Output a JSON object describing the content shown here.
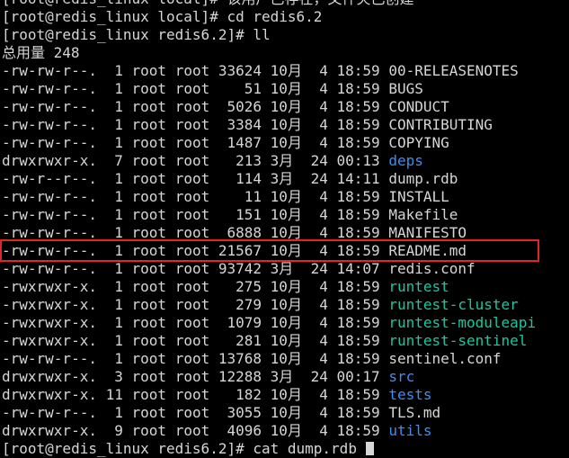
{
  "terminal": {
    "lines": [
      "[root@redis_linux local]# 该用户已存在，文件夹已创建",
      "[root@redis_linux local]# cd redis6.2",
      "[root@redis_linux redis6.2]# ll",
      "总用量 248"
    ],
    "files": [
      {
        "perm": "-rw-rw-r--.",
        "links": " 1",
        "owner": "root",
        "group": "root",
        "size": "33624",
        "month": "10月",
        "day": " 4",
        "time": "18:59",
        "name": "00-RELEASENOTES",
        "kind": "file"
      },
      {
        "perm": "-rw-rw-r--.",
        "links": " 1",
        "owner": "root",
        "group": "root",
        "size": "   51",
        "month": "10月",
        "day": " 4",
        "time": "18:59",
        "name": "BUGS",
        "kind": "file"
      },
      {
        "perm": "-rw-rw-r--.",
        "links": " 1",
        "owner": "root",
        "group": "root",
        "size": " 5026",
        "month": "10月",
        "day": " 4",
        "time": "18:59",
        "name": "CONDUCT",
        "kind": "file"
      },
      {
        "perm": "-rw-rw-r--.",
        "links": " 1",
        "owner": "root",
        "group": "root",
        "size": " 3384",
        "month": "10月",
        "day": " 4",
        "time": "18:59",
        "name": "CONTRIBUTING",
        "kind": "file"
      },
      {
        "perm": "-rw-rw-r--.",
        "links": " 1",
        "owner": "root",
        "group": "root",
        "size": " 1487",
        "month": "10月",
        "day": " 4",
        "time": "18:59",
        "name": "COPYING",
        "kind": "file"
      },
      {
        "perm": "drwxrwxr-x.",
        "links": " 7",
        "owner": "root",
        "group": "root",
        "size": "  213",
        "month": "3月 ",
        "day": "24",
        "time": "00:13",
        "name": "deps",
        "kind": "dir"
      },
      {
        "perm": "-rw-r--r--.",
        "links": " 1",
        "owner": "root",
        "group": "root",
        "size": "  114",
        "month": "3月 ",
        "day": "24",
        "time": "14:11",
        "name": "dump.rdb",
        "kind": "file"
      },
      {
        "perm": "-rw-rw-r--.",
        "links": " 1",
        "owner": "root",
        "group": "root",
        "size": "   11",
        "month": "10月",
        "day": " 4",
        "time": "18:59",
        "name": "INSTALL",
        "kind": "file"
      },
      {
        "perm": "-rw-rw-r--.",
        "links": " 1",
        "owner": "root",
        "group": "root",
        "size": "  151",
        "month": "10月",
        "day": " 4",
        "time": "18:59",
        "name": "Makefile",
        "kind": "file"
      },
      {
        "perm": "-rw-rw-r--.",
        "links": " 1",
        "owner": "root",
        "group": "root",
        "size": " 6888",
        "month": "10月",
        "day": " 4",
        "time": "18:59",
        "name": "MANIFESTO",
        "kind": "file"
      },
      {
        "perm": "-rw-rw-r--.",
        "links": " 1",
        "owner": "root",
        "group": "root",
        "size": "21567",
        "month": "10月",
        "day": " 4",
        "time": "18:59",
        "name": "README.md",
        "kind": "file"
      },
      {
        "perm": "-rw-rw-r--.",
        "links": " 1",
        "owner": "root",
        "group": "root",
        "size": "93742",
        "month": "3月 ",
        "day": "24",
        "time": "14:07",
        "name": "redis.conf",
        "kind": "file"
      },
      {
        "perm": "-rwxrwxr-x.",
        "links": " 1",
        "owner": "root",
        "group": "root",
        "size": "  275",
        "month": "10月",
        "day": " 4",
        "time": "18:59",
        "name": "runtest",
        "kind": "exec"
      },
      {
        "perm": "-rwxrwxr-x.",
        "links": " 1",
        "owner": "root",
        "group": "root",
        "size": "  279",
        "month": "10月",
        "day": " 4",
        "time": "18:59",
        "name": "runtest-cluster",
        "kind": "exec"
      },
      {
        "perm": "-rwxrwxr-x.",
        "links": " 1",
        "owner": "root",
        "group": "root",
        "size": " 1079",
        "month": "10月",
        "day": " 4",
        "time": "18:59",
        "name": "runtest-moduleapi",
        "kind": "exec"
      },
      {
        "perm": "-rwxrwxr-x.",
        "links": " 1",
        "owner": "root",
        "group": "root",
        "size": "  281",
        "month": "10月",
        "day": " 4",
        "time": "18:59",
        "name": "runtest-sentinel",
        "kind": "exec"
      },
      {
        "perm": "-rw-rw-r--.",
        "links": " 1",
        "owner": "root",
        "group": "root",
        "size": "13768",
        "month": "10月",
        "day": " 4",
        "time": "18:59",
        "name": "sentinel.conf",
        "kind": "file"
      },
      {
        "perm": "drwxrwxr-x.",
        "links": " 3",
        "owner": "root",
        "group": "root",
        "size": "12288",
        "month": "3月 ",
        "day": "24",
        "time": "00:17",
        "name": "src",
        "kind": "dir"
      },
      {
        "perm": "drwxrwxr-x.",
        "links": "11",
        "owner": "root",
        "group": "root",
        "size": "  182",
        "month": "10月",
        "day": " 4",
        "time": "18:59",
        "name": "tests",
        "kind": "dir"
      },
      {
        "perm": "-rw-rw-r--.",
        "links": " 1",
        "owner": "root",
        "group": "root",
        "size": " 3055",
        "month": "10月",
        "day": " 4",
        "time": "18:59",
        "name": "TLS.md",
        "kind": "file"
      },
      {
        "perm": "drwxrwxr-x.",
        "links": " 9",
        "owner": "root",
        "group": "root",
        "size": " 4096",
        "month": "10月",
        "day": " 4",
        "time": "18:59",
        "name": "utils",
        "kind": "dir"
      }
    ],
    "last_prompt": "[root@redis_linux redis6.2]# cat dump.rdb",
    "highlight_file": "dump.rdb"
  },
  "colors": {
    "background": "#000000",
    "text": "#d6d6d6",
    "directory": "#3a8ef6",
    "executable": "#18c8a0",
    "highlight_box": "#e0262b"
  }
}
